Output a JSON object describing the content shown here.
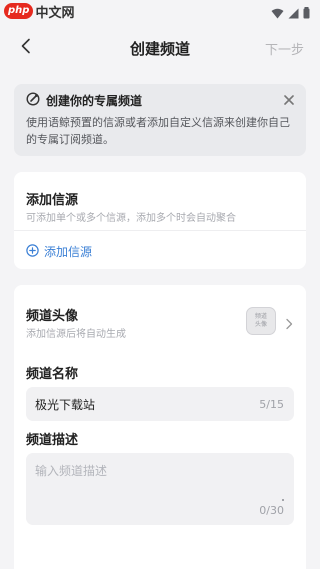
{
  "status_bar": {
    "watermark_badge": "php",
    "watermark_text": "中文网",
    "icons": [
      "wifi-icon",
      "cellular-signal-icon",
      "battery-icon"
    ]
  },
  "nav": {
    "title": "创建频道",
    "next_label": "下一步",
    "back_icon": "chevron-left-icon"
  },
  "notice": {
    "title": "创建你的专属频道",
    "body": "使用语鲸预置的信源或者添加自定义信源来创建你自己的专属订阅频道。",
    "icon": "rocket-badge-icon",
    "close_icon": "close-icon"
  },
  "sources": {
    "title": "添加信源",
    "subtitle": "可添加单个或多个信源，添加多个时会自动聚合",
    "add_label": "添加信源",
    "add_icon": "plus-circle-icon"
  },
  "channel": {
    "avatar_title": "频道头像",
    "avatar_subtitle": "添加信源后将自动生成",
    "avatar_placeholder_line1": "频道",
    "avatar_placeholder_line2": "头像",
    "name_label": "频道名称",
    "name_value": "极光下载站",
    "name_count": "5/15",
    "desc_label": "频道描述",
    "desc_placeholder": "输入频道描述",
    "desc_count": "0/30"
  },
  "colors": {
    "accent": "#3a7fd5",
    "background": "#f4f4f6",
    "card": "#ffffff",
    "notice_bg": "#e9eaed",
    "watermark_red": "#e62a1f"
  }
}
